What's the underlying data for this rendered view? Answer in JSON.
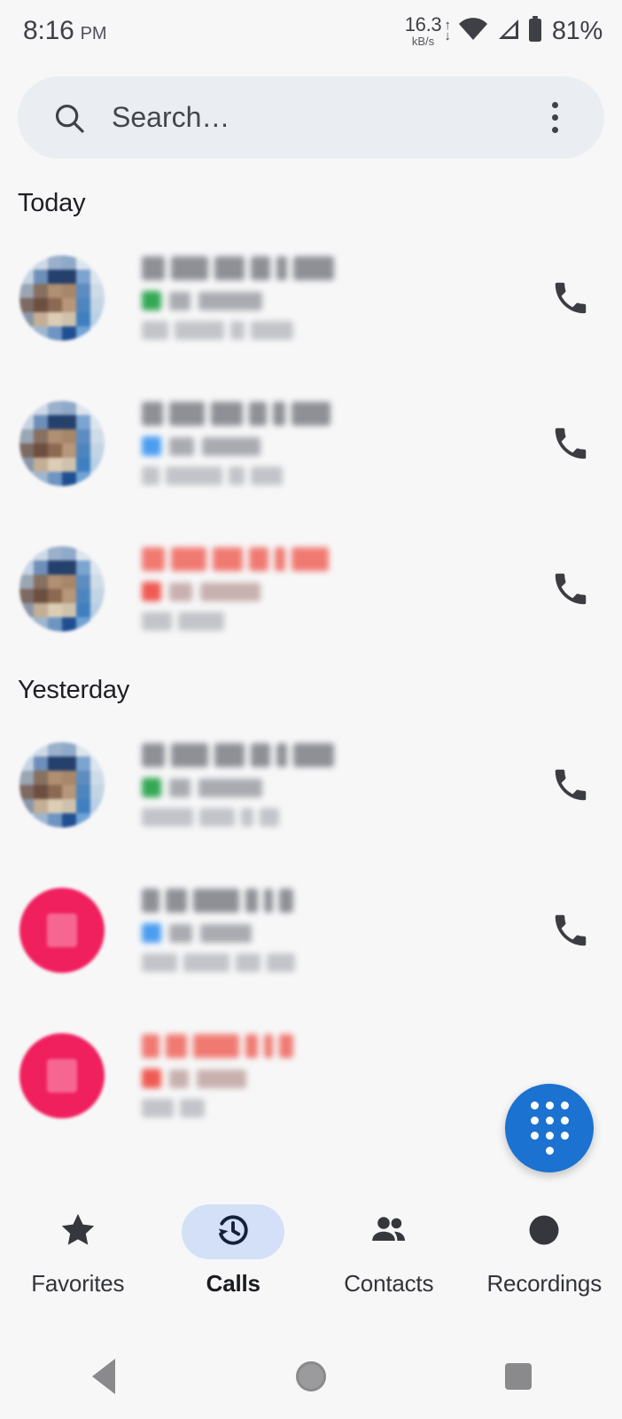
{
  "status_bar": {
    "time": "8:16",
    "ampm": "PM",
    "net_rate": "16.3",
    "net_unit": "kB/s",
    "arrow_up": "↑",
    "arrow_down": "↓",
    "battery_percent": "81%",
    "icons": [
      "wifi-icon",
      "cellular-signal-icon",
      "battery-icon"
    ]
  },
  "search": {
    "placeholder": "Search…",
    "value": "",
    "search_icon": "search-icon",
    "overflow_icon": "more-vert-icon"
  },
  "sections": [
    {
      "header": "Today"
    },
    {
      "header": "Yesterday"
    }
  ],
  "calls": {
    "today": [
      {
        "avatar_type": "photo",
        "name": "[redacted]",
        "name_state": "normal",
        "call_type": "incoming",
        "call_type_color": "#34a853",
        "call_type_label": "[redacted]",
        "time": "[redacted]",
        "action_icon": "phone-icon"
      },
      {
        "avatar_type": "photo",
        "name": "[redacted]",
        "name_state": "normal",
        "call_type": "outgoing",
        "call_type_color": "#4a9df0",
        "call_type_label": "[redacted]",
        "time": "[redacted]",
        "action_icon": "phone-icon"
      },
      {
        "avatar_type": "photo",
        "name": "[redacted]",
        "name_state": "missed",
        "call_type": "missed",
        "call_type_color": "#ef5a52",
        "call_type_label": "[redacted]",
        "time": "[redacted]",
        "action_icon": "phone-icon"
      }
    ],
    "yesterday": [
      {
        "avatar_type": "photo",
        "name": "[redacted]",
        "name_state": "normal",
        "call_type": "incoming",
        "call_type_color": "#34a853",
        "call_type_label": "[redacted]",
        "time": "[redacted]",
        "action_icon": "phone-icon"
      },
      {
        "avatar_type": "letter",
        "avatar_color": "#f01f5e",
        "name": "[redacted]",
        "name_state": "normal",
        "call_type": "outgoing",
        "call_type_color": "#4a9df0",
        "call_type_label": "[redacted]",
        "time": "[redacted]",
        "action_icon": "phone-icon"
      },
      {
        "avatar_type": "letter",
        "avatar_color": "#f01f5e",
        "name": "[redacted]",
        "name_state": "missed",
        "call_type": "missed",
        "call_type_color": "#ef5a52",
        "call_type_label": "[redacted]",
        "time": "[redacted]",
        "action_icon": "phone-icon"
      }
    ]
  },
  "fab": {
    "icon": "dialpad-icon",
    "color": "#1b72d0"
  },
  "bottom_nav": {
    "items": [
      {
        "label": "Favorites",
        "icon": "star-icon",
        "active": false
      },
      {
        "label": "Calls",
        "icon": "call-history-icon",
        "active": true
      },
      {
        "label": "Contacts",
        "icon": "people-icon",
        "active": false
      },
      {
        "label": "Recordings",
        "icon": "record-circle-icon",
        "active": false
      }
    ],
    "active_pill_color": "#d3e0f7"
  },
  "android_nav": {
    "back": "back-triangle-icon",
    "home": "home-circle-icon",
    "recents": "recents-square-icon"
  },
  "colors": {
    "page_background": "#f7f7f8",
    "search_background": "#eaeef2",
    "accent": "#1b72d0",
    "missed": "#ef5a52",
    "incoming": "#34a853",
    "outgoing": "#4a9df0"
  }
}
